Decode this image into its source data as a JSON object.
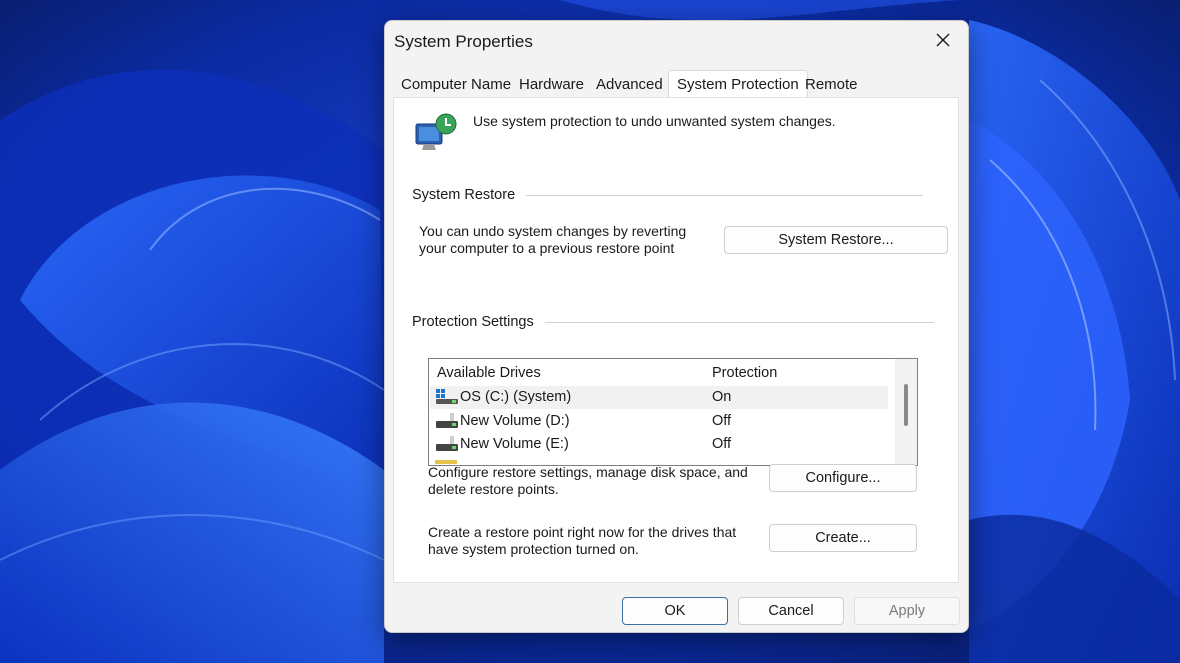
{
  "dialog": {
    "title": "System Properties"
  },
  "tabs": [
    {
      "label": "Computer Name"
    },
    {
      "label": "Hardware"
    },
    {
      "label": "Advanced"
    },
    {
      "label": "System Protection",
      "active": true
    },
    {
      "label": "Remote"
    }
  ],
  "header_text": "Use system protection to undo unwanted system changes.",
  "system_restore": {
    "group_label": "System Restore",
    "description_line1": "You can undo system changes by reverting",
    "description_line2": "your computer to a previous restore point",
    "button": "System Restore..."
  },
  "protection_settings": {
    "group_label": "Protection Settings",
    "columns": [
      "Available Drives",
      "Protection"
    ],
    "drives": [
      {
        "name": "OS (C:) (System)",
        "protection": "On",
        "icon": "system-drive-icon",
        "selected": true
      },
      {
        "name": "New Volume (D:)",
        "protection": "Off",
        "icon": "drive-icon"
      },
      {
        "name": "New Volume (E:)",
        "protection": "Off",
        "icon": "drive-icon"
      }
    ],
    "configure_line1": "Configure restore settings, manage disk space, and",
    "configure_line2": "delete restore points.",
    "configure_button": "Configure...",
    "create_line1": "Create a restore point right now for the drives that",
    "create_line2": "have system protection turned on.",
    "create_button": "Create..."
  },
  "footer": {
    "ok": "OK",
    "cancel": "Cancel",
    "apply": "Apply"
  }
}
